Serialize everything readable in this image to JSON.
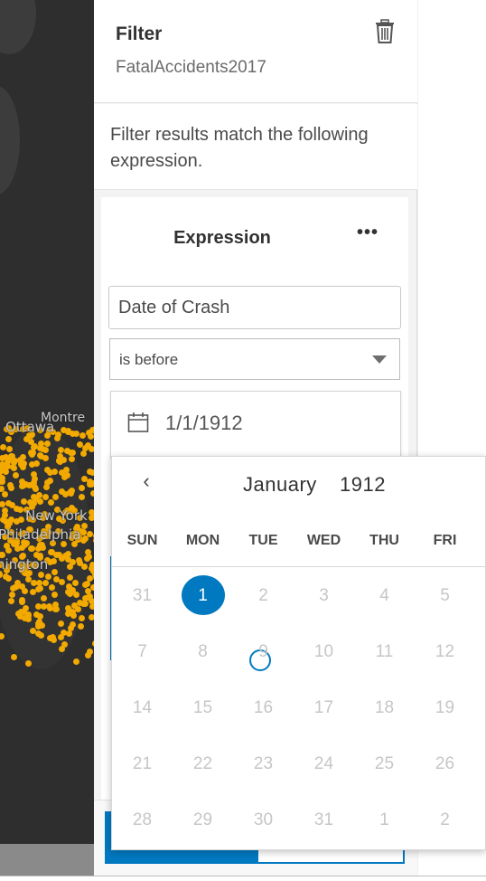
{
  "map": {
    "cities": [
      "Ottawa",
      "Montre",
      "New York",
      "Philadelphia",
      "hington"
    ]
  },
  "panel": {
    "title": "Filter",
    "subtitle": "FatalAccidents2017",
    "description": "Filter results match the following expression.",
    "expression": {
      "title": "Expression",
      "more_label": "•••",
      "field_value": "Date of Crash",
      "operator_value": "is before",
      "date_value": "1/1/1912"
    }
  },
  "datepicker": {
    "prev_label": "‹",
    "month": "January",
    "year": "1912",
    "weekdays": [
      "SUN",
      "MON",
      "TUE",
      "WED",
      "THU",
      "FRI"
    ],
    "weeks": [
      [
        {
          "d": "31",
          "cur": false
        },
        {
          "d": "1",
          "cur": true,
          "sel": true
        },
        {
          "d": "2",
          "cur": false
        },
        {
          "d": "3",
          "cur": false
        },
        {
          "d": "4",
          "cur": false
        },
        {
          "d": "5",
          "cur": false
        }
      ],
      [
        {
          "d": "7",
          "cur": false
        },
        {
          "d": "8",
          "cur": false
        },
        {
          "d": "9",
          "cur": false
        },
        {
          "d": "10",
          "cur": false
        },
        {
          "d": "11",
          "cur": false
        },
        {
          "d": "12",
          "cur": false
        }
      ],
      [
        {
          "d": "14",
          "cur": false
        },
        {
          "d": "15",
          "cur": false
        },
        {
          "d": "16",
          "cur": false
        },
        {
          "d": "17",
          "cur": false
        },
        {
          "d": "18",
          "cur": false
        },
        {
          "d": "19",
          "cur": false
        }
      ],
      [
        {
          "d": "21",
          "cur": false
        },
        {
          "d": "22",
          "cur": false
        },
        {
          "d": "23",
          "cur": false
        },
        {
          "d": "24",
          "cur": false
        },
        {
          "d": "25",
          "cur": false
        },
        {
          "d": "26",
          "cur": false
        }
      ],
      [
        {
          "d": "28",
          "cur": false
        },
        {
          "d": "29",
          "cur": false
        },
        {
          "d": "30",
          "cur": false
        },
        {
          "d": "31",
          "cur": false
        },
        {
          "d": "1",
          "cur": false
        },
        {
          "d": "2",
          "cur": false
        }
      ]
    ]
  },
  "icons": {
    "trash": "trash-icon",
    "calendar": "calendar-icon",
    "more": "more-horizontal-icon",
    "dropdown": "caret-down-icon",
    "prev": "chevron-left-icon"
  },
  "colors": {
    "accent": "#0079c1",
    "map_bg": "#2e2e2e",
    "points": "#f2a900"
  }
}
